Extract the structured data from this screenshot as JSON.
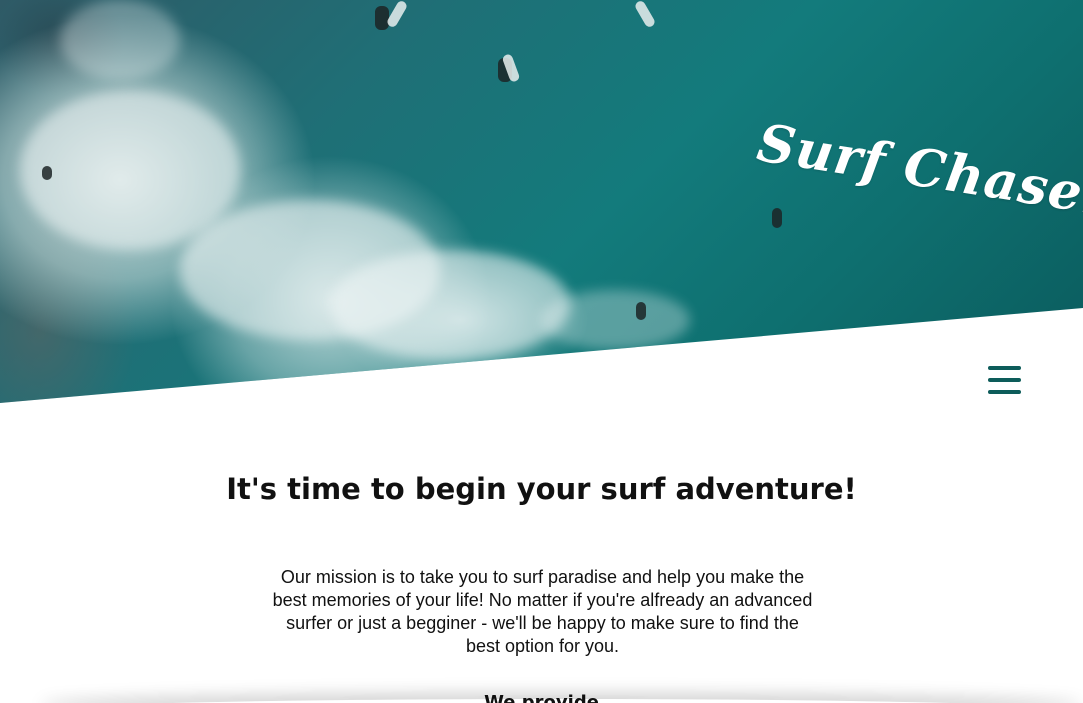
{
  "brand": {
    "logo_text": "Surf Chasers"
  },
  "nav": {
    "menu_icon": "hamburger-menu-icon"
  },
  "hero": {
    "image_subject": "aerial ocean waves with surfers"
  },
  "main": {
    "headline": "It's time to begin your surf adventure!",
    "mission": "Our mission is to take you to surf paradise and help you make the best memories of your life! No matter if you're alfready an advanced surfer or just a begginer - we'll be happy to make sure to find the best option for you.",
    "subheading": "We provide"
  },
  "colors": {
    "accent": "#0d5c5a",
    "text": "#111111",
    "background": "#ffffff"
  }
}
